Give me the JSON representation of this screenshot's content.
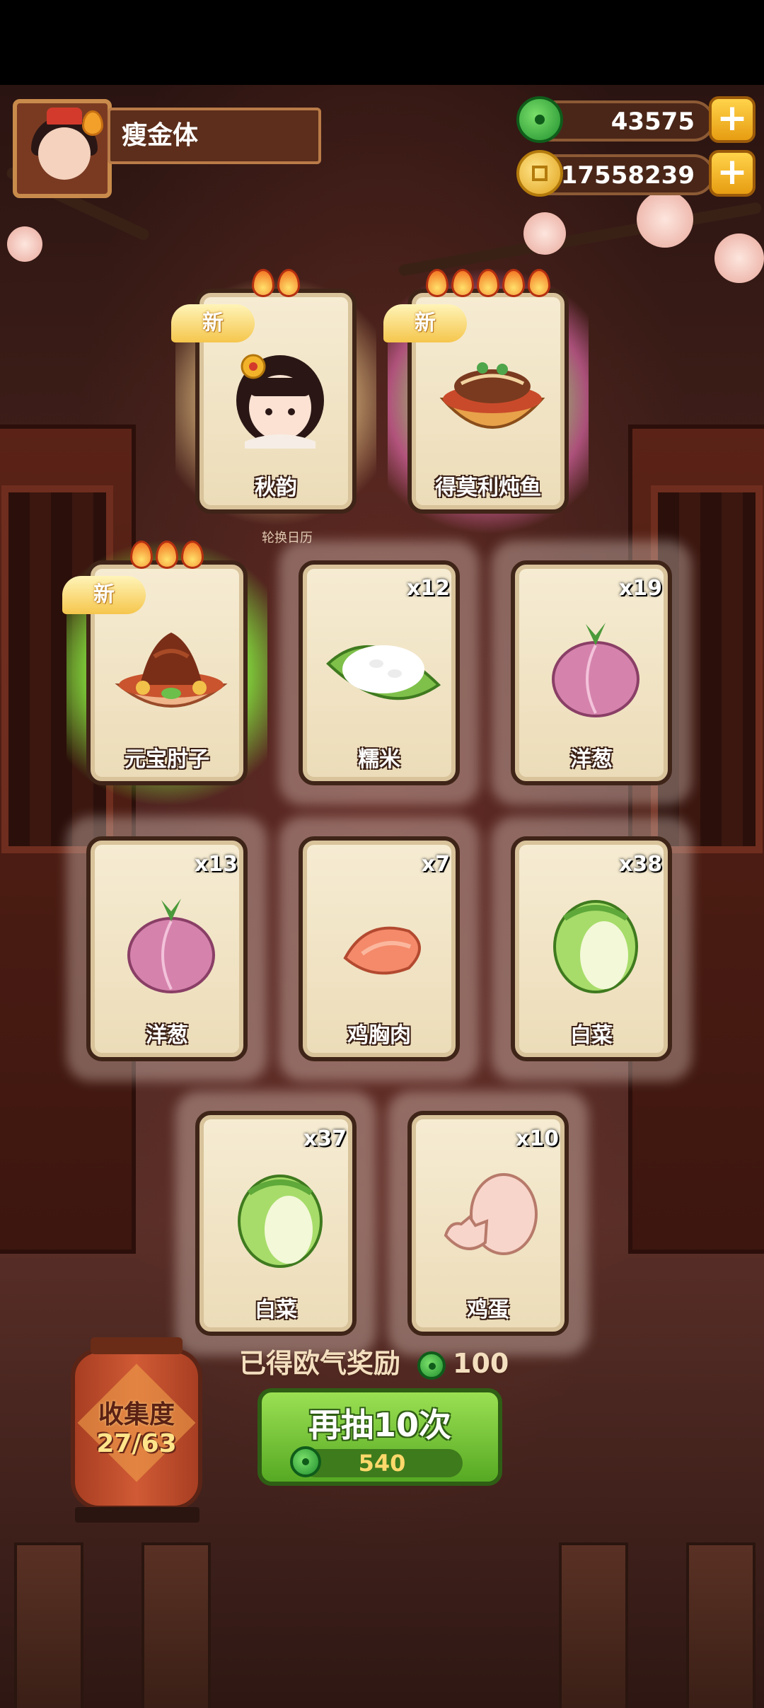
{
  "player": {
    "name": "瘦金体"
  },
  "currencies": {
    "jade": "43575",
    "coins": "17558239"
  },
  "add_label": "+",
  "new_label": "新",
  "background_text": "轮换日历",
  "cards": [
    {
      "name": "秋韵",
      "qty": "",
      "is_new": true,
      "flames": 2,
      "glow": "gold",
      "art": "portrait"
    },
    {
      "name": "得莫利炖鱼",
      "qty": "",
      "is_new": true,
      "flames": 5,
      "glow": "rainbow",
      "art": "fish-stew"
    },
    {
      "name": "元宝肘子",
      "qty": "",
      "is_new": true,
      "flames": 3,
      "glow": "green",
      "art": "pork-knuckle"
    },
    {
      "name": "糯米",
      "qty": "x12",
      "is_new": false,
      "flames": 0,
      "glow": "soft",
      "art": "rice"
    },
    {
      "name": "洋葱",
      "qty": "x19",
      "is_new": false,
      "flames": 0,
      "glow": "soft",
      "art": "onion"
    },
    {
      "name": "洋葱",
      "qty": "x13",
      "is_new": false,
      "flames": 0,
      "glow": "soft",
      "art": "onion"
    },
    {
      "name": "鸡胸肉",
      "qty": "x7",
      "is_new": false,
      "flames": 0,
      "glow": "soft",
      "art": "chicken"
    },
    {
      "name": "白菜",
      "qty": "x38",
      "is_new": false,
      "flames": 0,
      "glow": "soft",
      "art": "cabbage"
    },
    {
      "name": "白菜",
      "qty": "x37",
      "is_new": false,
      "flames": 0,
      "glow": "soft",
      "art": "cabbage"
    },
    {
      "name": "鸡蛋",
      "qty": "x10",
      "is_new": false,
      "flames": 0,
      "glow": "soft",
      "art": "egg"
    }
  ],
  "luck_reward": {
    "label": "已得欧气奖励",
    "amount": "100"
  },
  "collection": {
    "label": "收集度",
    "progress": "27/63"
  },
  "redraw": {
    "label": "再抽10次",
    "cost": "540"
  }
}
